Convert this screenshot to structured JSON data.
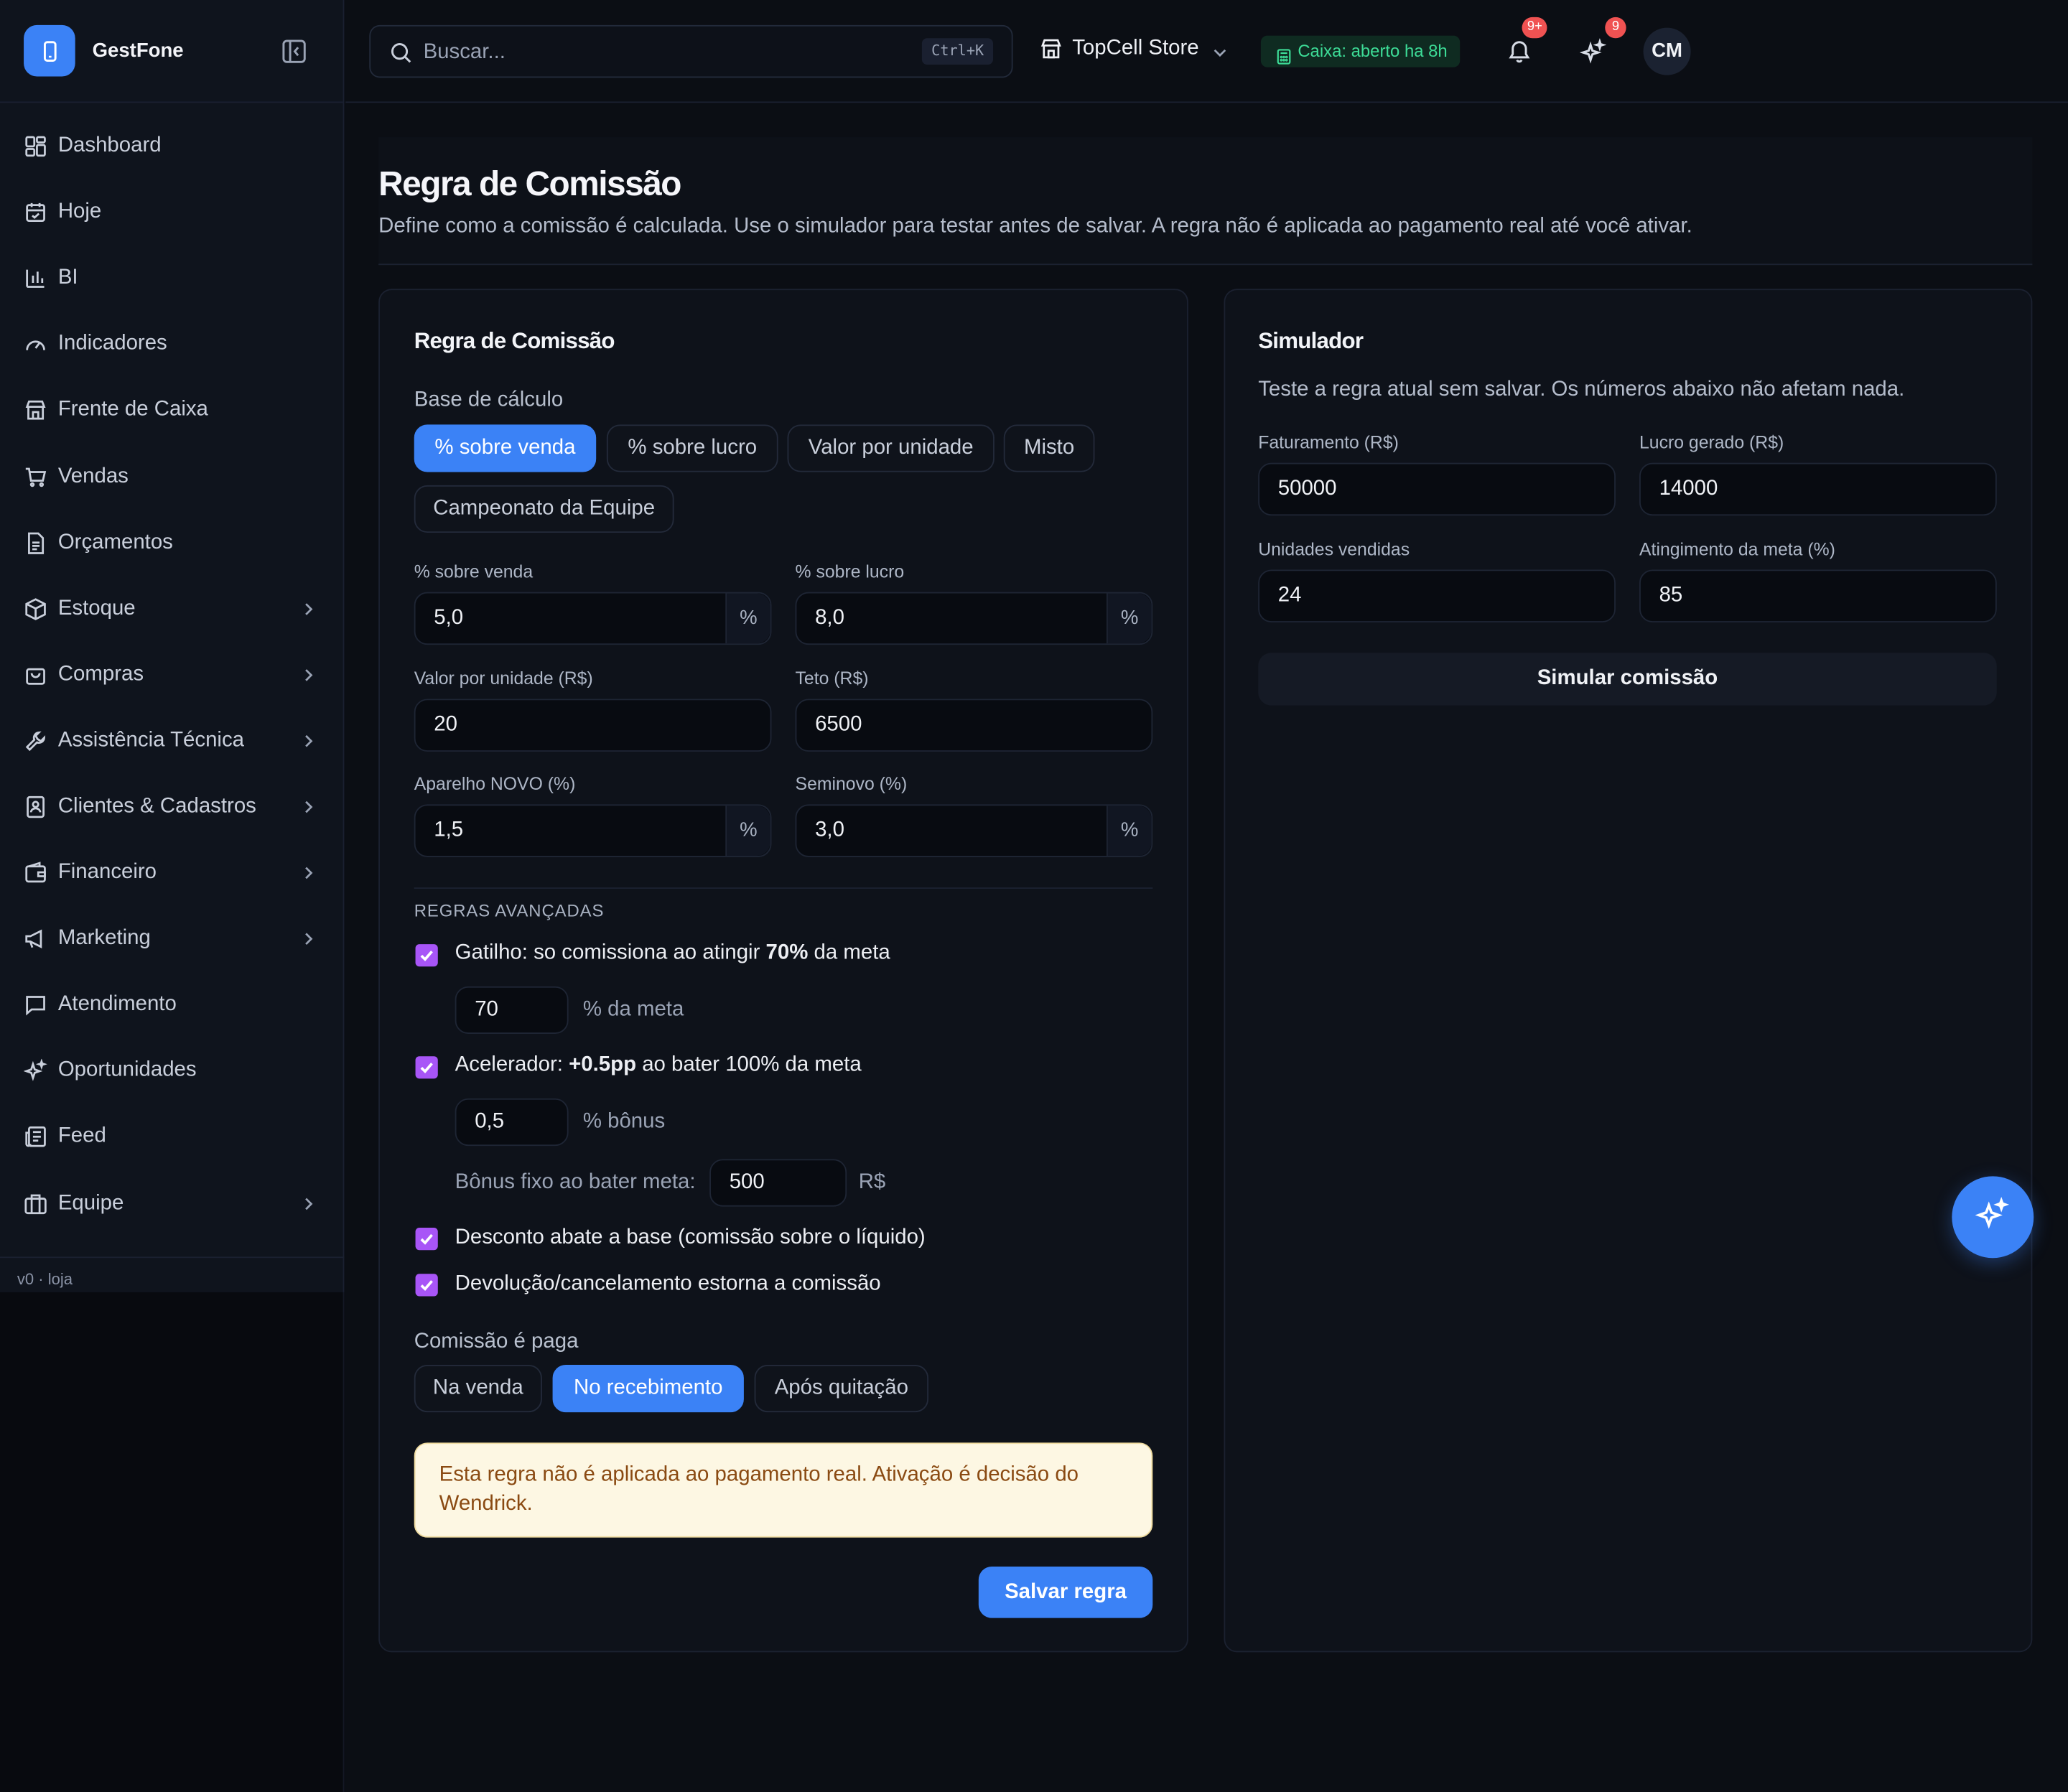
{
  "app": {
    "name": "GestFone",
    "version": "v0 · loja"
  },
  "sidebar": {
    "items": [
      {
        "label": "Dashboard",
        "icon": "dashboard-icon",
        "chevron": false
      },
      {
        "label": "Hoje",
        "icon": "calendar-icon",
        "chevron": false
      },
      {
        "label": "BI",
        "icon": "bar-chart-icon",
        "chevron": false
      },
      {
        "label": "Indicadores",
        "icon": "gauge-icon",
        "chevron": false
      },
      {
        "label": "Frente de Caixa",
        "icon": "store-icon",
        "chevron": false
      },
      {
        "label": "Vendas",
        "icon": "cart-icon",
        "chevron": false
      },
      {
        "label": "Orçamentos",
        "icon": "document-icon",
        "chevron": false
      },
      {
        "label": "Estoque",
        "icon": "package-icon",
        "chevron": true
      },
      {
        "label": "Compras",
        "icon": "shopping-bag-icon",
        "chevron": true
      },
      {
        "label": "Assistência Técnica",
        "icon": "wrench-icon",
        "chevron": true
      },
      {
        "label": "Clientes & Cadastros",
        "icon": "contact-icon",
        "chevron": true
      },
      {
        "label": "Financeiro",
        "icon": "wallet-icon",
        "chevron": true
      },
      {
        "label": "Marketing",
        "icon": "megaphone-icon",
        "chevron": true
      },
      {
        "label": "Atendimento",
        "icon": "message-icon",
        "chevron": false
      },
      {
        "label": "Oportunidades",
        "icon": "sparkles-icon",
        "chevron": false
      },
      {
        "label": "Feed",
        "icon": "newspaper-icon",
        "chevron": false
      },
      {
        "label": "Equipe",
        "icon": "briefcase-icon",
        "chevron": true
      }
    ]
  },
  "topbar": {
    "search_placeholder": "Buscar...",
    "shortcut": "Ctrl+K",
    "store": "TopCell Store",
    "caixa_status": "Caixa: aberto ha 8h",
    "notifications_badge": "9+",
    "ai_badge": "9",
    "avatar_initials": "CM"
  },
  "page": {
    "title": "Regra de Comissão",
    "subtitle": "Define como a comissão é calculada. Use o simulador para testar antes de salvar. A regra não é aplicada ao pagamento real até você ativar."
  },
  "rule": {
    "title": "Regra de Comissão",
    "base_label": "Base de cálculo",
    "base_options": [
      "% sobre venda",
      "% sobre lucro",
      "Valor por unidade",
      "Misto",
      "Campeonato da Equipe"
    ],
    "base_selected": "% sobre venda",
    "fields": {
      "pct_venda": {
        "label": "% sobre venda",
        "value": "5,0",
        "suffix": "%"
      },
      "pct_lucro": {
        "label": "% sobre lucro",
        "value": "8,0",
        "suffix": "%"
      },
      "valor_unidade": {
        "label": "Valor por unidade (R$)",
        "value": "20"
      },
      "teto": {
        "label": "Teto (R$)",
        "value": "6500"
      },
      "aparelho_novo": {
        "label": "Aparelho NOVO (%)",
        "value": "1,5",
        "suffix": "%"
      },
      "seminovo": {
        "label": "Seminovo (%)",
        "value": "3,0",
        "suffix": "%"
      }
    },
    "advanced_caption": "REGRAS AVANÇADAS",
    "gatilho": {
      "text_pre": "Gatilho: so comissiona ao atingir ",
      "text_bold": "70%",
      "text_post": " da meta",
      "checked": true,
      "value": "70",
      "unit": "% da meta"
    },
    "acelerador": {
      "text_pre": "Acelerador: ",
      "text_bold": "+0.5pp",
      "text_post": " ao bater 100% da meta",
      "checked": true,
      "value": "0,5",
      "unit": "% bônus"
    },
    "bonus_fixo": {
      "label": "Bônus fixo ao bater meta:",
      "value": "500",
      "unit": "R$"
    },
    "desconto": {
      "text": "Desconto abate a base (comissão sobre o líquido)",
      "checked": true
    },
    "devolucao": {
      "text": "Devolução/cancelamento estorna a comissão",
      "checked": true
    },
    "paid_label": "Comissão é paga",
    "paid_options": [
      "Na venda",
      "No recebimento",
      "Após quitação"
    ],
    "paid_selected": "No recebimento",
    "notice": "Esta regra não é aplicada ao pagamento real. Ativação é decisão do Wendrick.",
    "save_label": "Salvar regra"
  },
  "simulator": {
    "title": "Simulador",
    "description": "Teste a regra atual sem salvar. Os números abaixo não afetam nada.",
    "fields": {
      "faturamento": {
        "label": "Faturamento (R$)",
        "value": "50000"
      },
      "lucro": {
        "label": "Lucro gerado (R$)",
        "value": "14000"
      },
      "unidades": {
        "label": "Unidades vendidas",
        "value": "24"
      },
      "meta": {
        "label": "Atingimento da meta (%)",
        "value": "85"
      }
    },
    "button_label": "Simular comissão"
  },
  "colors": {
    "accent": "#3b82f6",
    "checkbox": "#a855f7",
    "caixa_text": "#3ddc97",
    "badge": "#f05252",
    "notice_bg": "#fdf7e3"
  }
}
